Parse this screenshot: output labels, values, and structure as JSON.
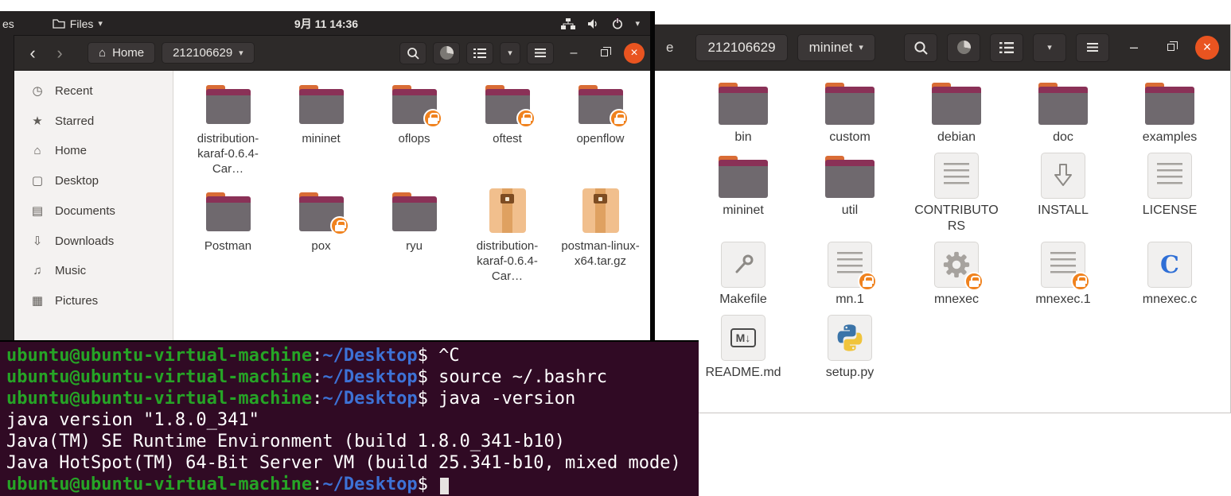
{
  "icons": {
    "back": "‹",
    "forward": "›",
    "caret": "▾",
    "minimize": "–",
    "close": "×",
    "home": "⌂",
    "markdown": "M↓"
  },
  "colors": {
    "accent_orange": "#e95420",
    "terminal_background": "#300a24",
    "prompt_green": "#26a426",
    "path_blue": "#3d72d6",
    "folder_gray": "#6f696e",
    "lock_badge_orange": "#f0821e"
  },
  "topbar": {
    "activities_cut": "es",
    "files_label": "Files",
    "clock": "9月 11 14:36"
  },
  "left_window": {
    "header": {
      "home_label": "Home",
      "folder_label": "212106629"
    },
    "sidebar": [
      {
        "id": "recent",
        "label": "Recent",
        "icon": "clock-icon",
        "glyph": "◷"
      },
      {
        "id": "starred",
        "label": "Starred",
        "icon": "star-icon",
        "glyph": "★"
      },
      {
        "id": "home",
        "label": "Home",
        "icon": "home-icon",
        "glyph": "⌂"
      },
      {
        "id": "desktop",
        "label": "Desktop",
        "icon": "desktop-icon",
        "glyph": "▢"
      },
      {
        "id": "documents",
        "label": "Documents",
        "icon": "document-icon",
        "glyph": "▤"
      },
      {
        "id": "downloads",
        "label": "Downloads",
        "icon": "download-icon",
        "glyph": "⇩"
      },
      {
        "id": "music",
        "label": "Music",
        "icon": "music-icon",
        "glyph": "♫"
      },
      {
        "id": "pictures",
        "label": "Pictures",
        "icon": "picture-icon",
        "glyph": "▦"
      }
    ],
    "files": [
      {
        "label": "distribution-karaf-0.6.4-Car…",
        "type": "folder",
        "locked": false
      },
      {
        "label": "mininet",
        "type": "folder",
        "locked": false
      },
      {
        "label": "oflops",
        "type": "folder",
        "locked": true
      },
      {
        "label": "oftest",
        "type": "folder",
        "locked": true
      },
      {
        "label": "openflow",
        "type": "folder",
        "locked": true
      },
      {
        "label": "Postman",
        "type": "folder",
        "locked": false
      },
      {
        "label": "pox",
        "type": "folder",
        "locked": true
      },
      {
        "label": "ryu",
        "type": "folder",
        "locked": false
      },
      {
        "label": "distribution-karaf-0.6.4-Car…",
        "type": "archive",
        "locked": false
      },
      {
        "label": "postman-linux-x64.tar.gz",
        "type": "archive",
        "locked": false
      }
    ]
  },
  "right_window": {
    "header": {
      "cut_text": "e",
      "parent_label": "212106629",
      "folder_label": "mininet"
    },
    "files": [
      {
        "label": "bin",
        "type": "folder"
      },
      {
        "label": "custom",
        "type": "folder"
      },
      {
        "label": "debian",
        "type": "folder"
      },
      {
        "label": "doc",
        "type": "folder"
      },
      {
        "label": "examples",
        "type": "folder"
      },
      {
        "label": "mininet",
        "type": "folder"
      },
      {
        "label": "util",
        "type": "folder"
      },
      {
        "label": "CONTRIBUTORS",
        "type": "text"
      },
      {
        "label": "INSTALL",
        "type": "install"
      },
      {
        "label": "LICENSE",
        "type": "text"
      },
      {
        "label": "Makefile",
        "type": "makefile"
      },
      {
        "label": "mn.1",
        "type": "text",
        "locked": true
      },
      {
        "label": "mnexec",
        "type": "gear",
        "locked": true
      },
      {
        "label": "mnexec.1",
        "type": "text",
        "locked": true
      },
      {
        "label": "mnexec.c",
        "type": "cfile"
      },
      {
        "label": "README.md",
        "type": "markdown"
      },
      {
        "label": "setup.py",
        "type": "python"
      }
    ]
  },
  "terminal": {
    "user_host": "ubuntu@ubuntu-virtual-machine",
    "cwd": "~/Desktop",
    "prompt_suffix": "$",
    "lines": [
      {
        "type": "prompt",
        "command": "^C"
      },
      {
        "type": "prompt",
        "command": "source ~/.bashrc"
      },
      {
        "type": "prompt",
        "command": "java -version"
      },
      {
        "type": "output",
        "text": "java version \"1.8.0_341\""
      },
      {
        "type": "output",
        "text": "Java(TM) SE Runtime Environment (build 1.8.0_341-b10)"
      },
      {
        "type": "output",
        "text": "Java HotSpot(TM) 64-Bit Server VM (build 25.341-b10, mixed mode)"
      },
      {
        "type": "prompt",
        "command": "",
        "cursor": true
      }
    ]
  }
}
